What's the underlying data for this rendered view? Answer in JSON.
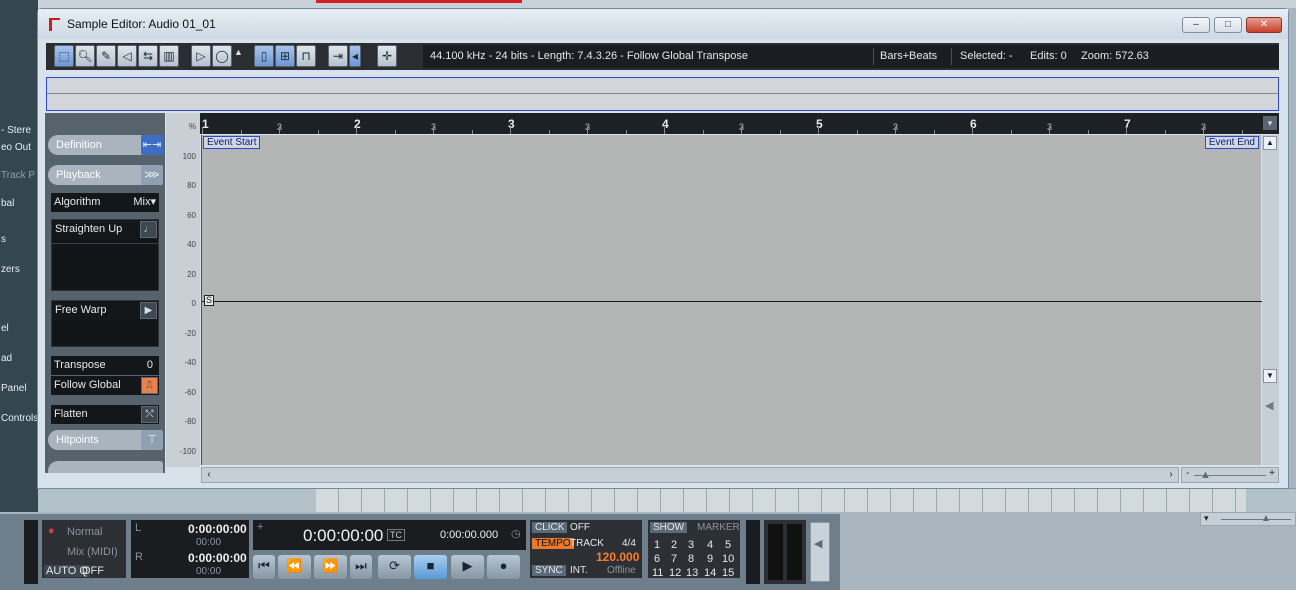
{
  "background": {
    "left_panel": [
      "- Stere",
      "eo Out",
      "Track P",
      "bal",
      "s",
      "zers",
      "el",
      "ad",
      "Panel",
      "Controls"
    ]
  },
  "window": {
    "title": "Sample Editor: Audio 01_01",
    "controls": {
      "minimize": "–",
      "maximize": "□",
      "close": "✕"
    }
  },
  "toolbar": {
    "tools": [
      "range-select",
      "zoom",
      "draw",
      "play",
      "scrub",
      "snap-hitpoints",
      "play-button",
      "loop-button"
    ],
    "info": {
      "format": "44.100 kHz - 24 bits - Length: 7.4.3.26 - Follow Global Transpose",
      "ruler_format": "Bars+Beats",
      "selected": "Selected: -",
      "edits": "Edits: 0",
      "zoom": "Zoom: 572.63"
    }
  },
  "inspector": {
    "definition": "Definition",
    "playback": "Playback",
    "algorithm_label": "Algorithm",
    "algorithm_value": "Mix",
    "straighten_up": "Straighten Up",
    "free_warp": "Free Warp",
    "transpose_label": "Transpose",
    "transpose_value": "0",
    "follow_global": "Follow Global",
    "flatten": "Flatten",
    "hitpoints": "Hitpoints"
  },
  "editor": {
    "percent_unit": "%",
    "scale_labels": [
      "100",
      "80",
      "60",
      "40",
      "20",
      "0",
      "-20",
      "-40",
      "-60",
      "-80",
      "-100"
    ],
    "bars": [
      "1",
      "2",
      "3",
      "4",
      "5",
      "6",
      "7"
    ],
    "beat_label": "3",
    "event_start": "Event Start",
    "event_end": "Event End",
    "silence_marker": "S"
  },
  "transport": {
    "mode_normal": "Normal",
    "mode_mix": "Mix (MIDI)",
    "auto_q": "AUTO Q",
    "auto_q_value": "OFF",
    "left_locator": "0:00:00:00",
    "left_sub": "00:00",
    "right_locator": "0:00:00:00",
    "right_sub": "00:00",
    "main_time": "0:00:00:00",
    "tc_badge": "TC",
    "secondary_time": "0:00:00.000",
    "click_label": "CLICK",
    "click_value": "OFF",
    "tempo_label": "TEMPO",
    "tempo_mode": "TRACK",
    "signature": "4/4",
    "tempo_value": "120.000",
    "sync_label": "SYNC",
    "sync_mode": "INT.",
    "sync_status": "Offline",
    "show_label": "SHOW",
    "marker_label": "MARKER",
    "markers": [
      "1",
      "2",
      "3",
      "4",
      "5",
      "6",
      "7",
      "8",
      "9",
      "10",
      "11",
      "12",
      "13",
      "14",
      "15"
    ]
  },
  "colors": {
    "accent": "#2c4ac8",
    "tempo_value": "#ff7a2a",
    "toolbar_bg": "#2a2e33"
  }
}
